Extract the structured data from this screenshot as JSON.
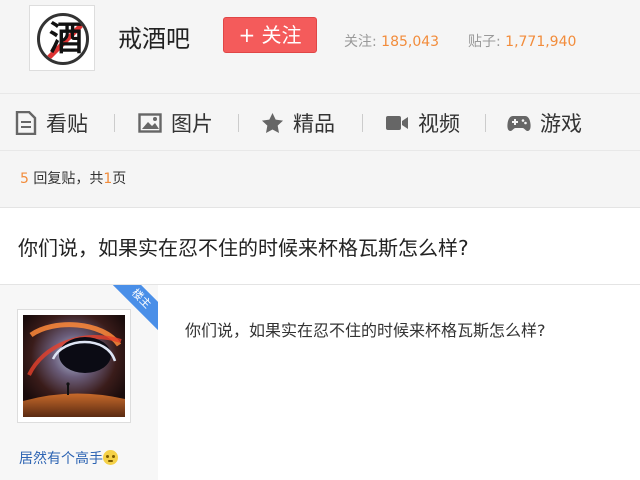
{
  "forum": {
    "logo_char": "酒",
    "name": "戒酒吧",
    "follow_label": "+ 关注",
    "stats": {
      "followers_label": "关注:",
      "followers_value": "185,043",
      "posts_label": "贴子:",
      "posts_value": "1,771,940"
    }
  },
  "nav": {
    "items": [
      {
        "label": "看贴",
        "icon": "document-icon"
      },
      {
        "label": "图片",
        "icon": "image-icon"
      },
      {
        "label": "精品",
        "icon": "star-icon"
      },
      {
        "label": "视频",
        "icon": "video-camera-icon"
      },
      {
        "label": "游戏",
        "icon": "gamepad-icon"
      }
    ]
  },
  "thread": {
    "reply_count": "5",
    "reply_text": "回复贴，共",
    "page_count": "1",
    "page_unit": "页",
    "title": "你们说，如果实在忍不住的时候来杯格瓦斯怎么样?"
  },
  "post": {
    "badge": "楼主",
    "author": "居然有个高手",
    "author_emoji": "flushed-face-emoji",
    "content": "你们说，如果实在忍不住的时候来杯格瓦斯怎么样?"
  },
  "colors": {
    "accent_orange": "#f28c3b",
    "follow_red": "#f45b5b",
    "link_blue": "#2d64b3",
    "badge_blue": "#4a8fe8"
  }
}
